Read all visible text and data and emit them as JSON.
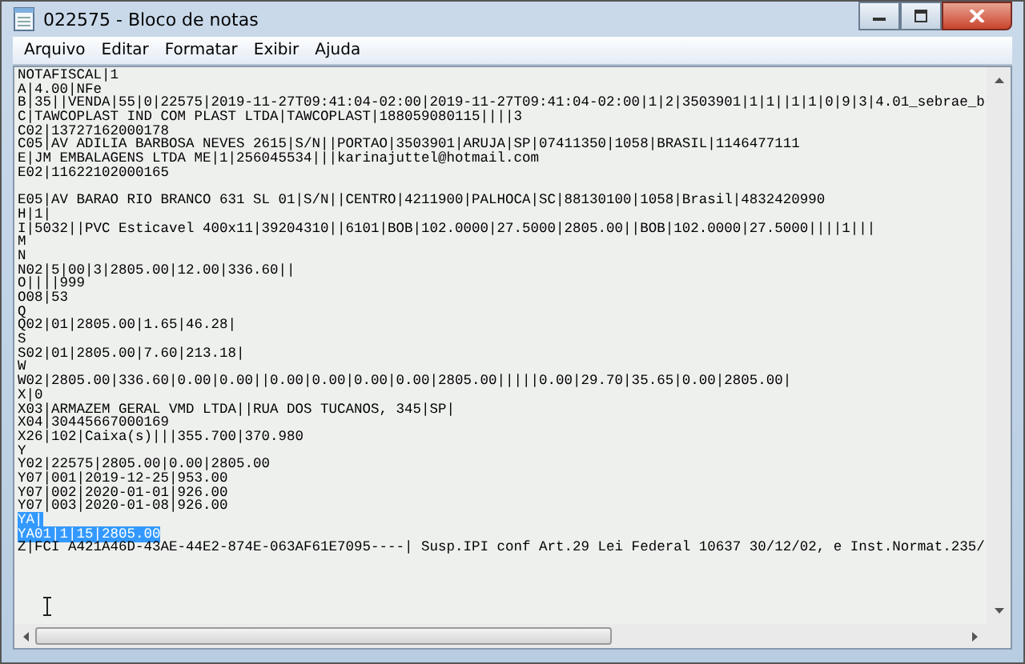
{
  "window": {
    "title": "022575 - Bloco de notas"
  },
  "menu": [
    "Arquivo",
    "Editar",
    "Formatar",
    "Exibir",
    "Ajuda"
  ],
  "lines": [
    {
      "kind": "text",
      "text": "NOTAFISCAL|1",
      "selected": false
    },
    {
      "kind": "text",
      "text": "A|4.00|NFe",
      "selected": false
    },
    {
      "kind": "text",
      "text": "B|35||VENDA|55|0|22575|2019-11-27T09:41:04-02:00|2019-11-27T09:41:04-02:00|1|2|3503901|1|1||1|1|0|9|3|4.01_sebrae_b",
      "selected": false
    },
    {
      "kind": "text",
      "text": "C|TAWCOPLAST IND COM PLAST LTDA|TAWCOPLAST|188059080115||||3",
      "selected": false
    },
    {
      "kind": "text",
      "text": "C02|13727162000178",
      "selected": false
    },
    {
      "kind": "text",
      "text": "C05|AV ADILIA BARBOSA NEVES 2615|S/N||PORTAO|3503901|ARUJA|SP|07411350|1058|BRASIL|1146477111",
      "selected": false
    },
    {
      "kind": "text",
      "text": "E|JM EMBALAGENS LTDA ME|1|256045534|||karinajuttel@hotmail.com",
      "selected": false
    },
    {
      "kind": "text",
      "text": "E02|11622102000165",
      "selected": false
    },
    {
      "kind": "blank"
    },
    {
      "kind": "text",
      "text": "E05|AV BARAO RIO BRANCO 631 SL 01|S/N||CENTRO|4211900|PALHOCA|SC|88130100|1058|Brasil|4832420990",
      "selected": false
    },
    {
      "kind": "text",
      "text": "H|1|",
      "selected": false
    },
    {
      "kind": "text",
      "text": "I|5032||PVC Esticavel 400x11|39204310||6101|BOB|102.0000|27.5000|2805.00||BOB|102.0000|27.5000||||1|||",
      "selected": false
    },
    {
      "kind": "text",
      "text": "M",
      "selected": false
    },
    {
      "kind": "text",
      "text": "N",
      "selected": false
    },
    {
      "kind": "text",
      "text": "N02|5|00|3|2805.00|12.00|336.60||",
      "selected": false
    },
    {
      "kind": "text",
      "text": "O||||999",
      "selected": false
    },
    {
      "kind": "text",
      "text": "O08|53",
      "selected": false
    },
    {
      "kind": "text",
      "text": "Q",
      "selected": false
    },
    {
      "kind": "text",
      "text": "Q02|01|2805.00|1.65|46.28|",
      "selected": false
    },
    {
      "kind": "text",
      "text": "S",
      "selected": false
    },
    {
      "kind": "text",
      "text": "S02|01|2805.00|7.60|213.18|",
      "selected": false
    },
    {
      "kind": "text",
      "text": "W",
      "selected": false
    },
    {
      "kind": "text",
      "text": "W02|2805.00|336.60|0.00|0.00||0.00|0.00|0.00|0.00|2805.00|||||0.00|29.70|35.65|0.00|2805.00|",
      "selected": false
    },
    {
      "kind": "text",
      "text": "X|0",
      "selected": false
    },
    {
      "kind": "text",
      "text": "X03|ARMAZEM GERAL VMD LTDA||RUA DOS TUCANOS, 345|SP|",
      "selected": false
    },
    {
      "kind": "text",
      "text": "X04|30445667000169",
      "selected": false
    },
    {
      "kind": "text",
      "text": "X26|102|Caixa(s)|||355.700|370.980",
      "selected": false
    },
    {
      "kind": "text",
      "text": "Y",
      "selected": false
    },
    {
      "kind": "text",
      "text": "Y02|22575|2805.00|0.00|2805.00",
      "selected": false
    },
    {
      "kind": "text",
      "text": "Y07|001|2019-12-25|953.00",
      "selected": false
    },
    {
      "kind": "text",
      "text": "Y07|002|2020-01-01|926.00",
      "selected": false
    },
    {
      "kind": "text",
      "text": "Y07|003|2020-01-08|926.00",
      "selected": false
    },
    {
      "kind": "text",
      "text": "YA|",
      "selected": true
    },
    {
      "kind": "text",
      "text": "YA01|1|15|2805.00",
      "selected": true
    },
    {
      "kind": "text",
      "text": "Z|FCI A421A46D-43AE-44E2-874E-063AF61E7095----| Susp.IPI conf Art.29 Lei Federal 10637 30/12/02, e Inst.Normat.235/",
      "selected": false
    }
  ]
}
